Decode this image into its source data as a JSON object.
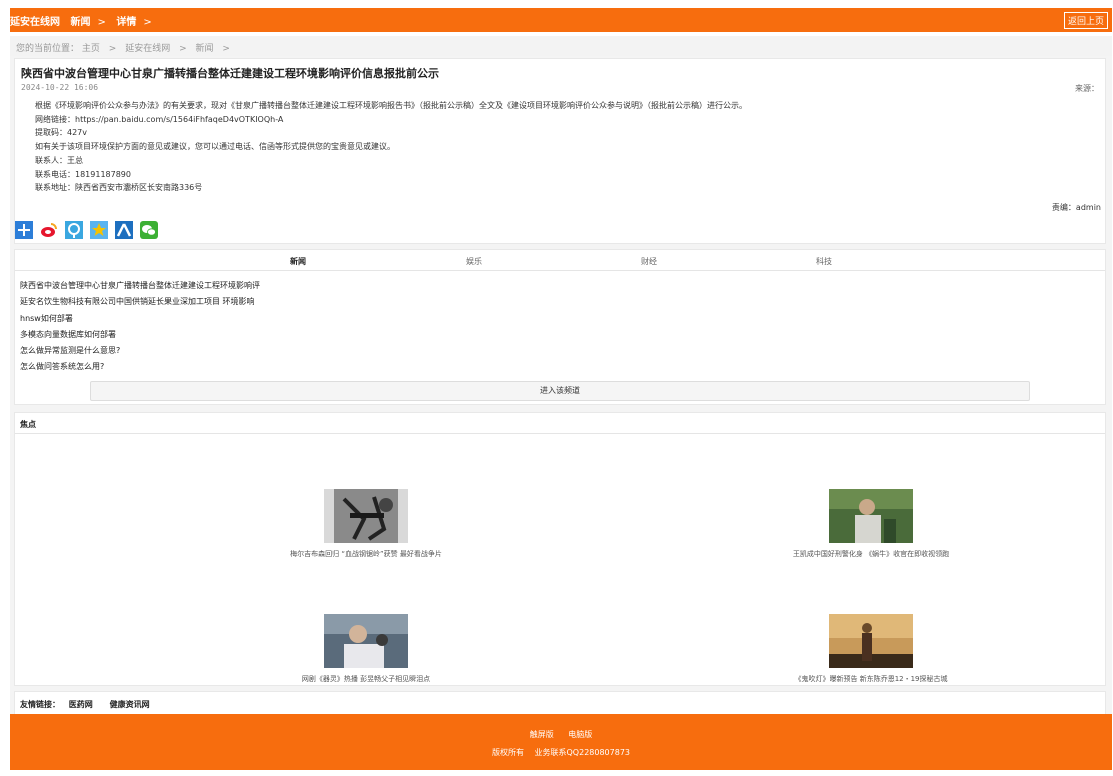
{
  "topbar": {
    "crumbs": [
      "延安在线网",
      "新闻",
      "详情"
    ],
    "sep": ">",
    "back_label": "返回上页"
  },
  "location": {
    "prefix": "您的当前位置：",
    "items": [
      "主页",
      ">",
      "延安在线网",
      ">",
      "新闻",
      ">"
    ]
  },
  "article": {
    "title": "陕西省中波台管理中心甘泉广播转播台整体迁建建设工程环境影响评价信息报批前公示",
    "date": "2024-10-22 16:06",
    "source_label": "来源：",
    "paragraphs": [
      "根据《环境影响评价公众参与办法》的有关要求，现对《甘泉广播转播台整体迁建建设工程环境影响报告书》（报批前公示稿）全文及《建设项目环境影响评价公众参与说明》（报批前公示稿）进行公示。",
      "网络链接：https://pan.baidu.com/s/1564iFhfaqeD4vOTKIOQh-A",
      "提取码：427v",
      "如有关于该项目环境保护方面的意见或建议，您可以通过电话、信函等形式提供您的宝贵意见或建议。",
      "联系人：王总",
      "联系电话：18191187890",
      "联系地址：陕西省西安市灞桥区长安南路336号"
    ],
    "editor": "责编：admin"
  },
  "share_icons": [
    {
      "name": "plus-share-icon",
      "color": "#2d7ed8",
      "glyph": "+"
    },
    {
      "name": "weibo-icon",
      "color": "#e6162d",
      "glyph": "微"
    },
    {
      "name": "tencent-weibo-icon",
      "color": "#3aa7e0",
      "glyph": "腾"
    },
    {
      "name": "qzone-icon",
      "color": "#f7b500",
      "glyph": "★"
    },
    {
      "name": "renren-icon",
      "color": "#1d6fbf",
      "glyph": "人"
    },
    {
      "name": "wechat-icon",
      "color": "#3cb034",
      "glyph": "微"
    }
  ],
  "tabs": [
    "新闻",
    "娱乐",
    "财经",
    "科技"
  ],
  "news_list": [
    "陕西省中波台管理中心甘泉广播转播台整体迁建建设工程环境影响评",
    "延安名饮生物科技有限公司中国供销延长果业深加工项目 环境影响",
    "hnsw如何部署",
    "多模态向量数据库如何部署",
    "怎么做异常监测是什么意思?",
    "怎么做问答系统怎么用?"
  ],
  "enter_channel": "进入该频道",
  "focus": {
    "heading": "焦点",
    "items": [
      {
        "caption": "梅尔吉布森回归 “血战钢锯岭”获赞 最好看战争片"
      },
      {
        "caption": "王凯成中国好刑警化身 《蜗牛》收官在即收视领跑"
      },
      {
        "caption": "网剧《器灵》热播 彭昱畅父子相见瞬泪点"
      },
      {
        "caption": "《鬼吹灯》曝新预告 新东陈乔恩12・19探秘古城"
      }
    ]
  },
  "links": {
    "label": "友情链接：",
    "items": [
      "医药网",
      "健康资讯网"
    ]
  },
  "footer": {
    "versions": [
      "触屏版",
      "电脑版"
    ],
    "copyright": "版权所有",
    "contact": "业务联系QQ2280807873"
  }
}
